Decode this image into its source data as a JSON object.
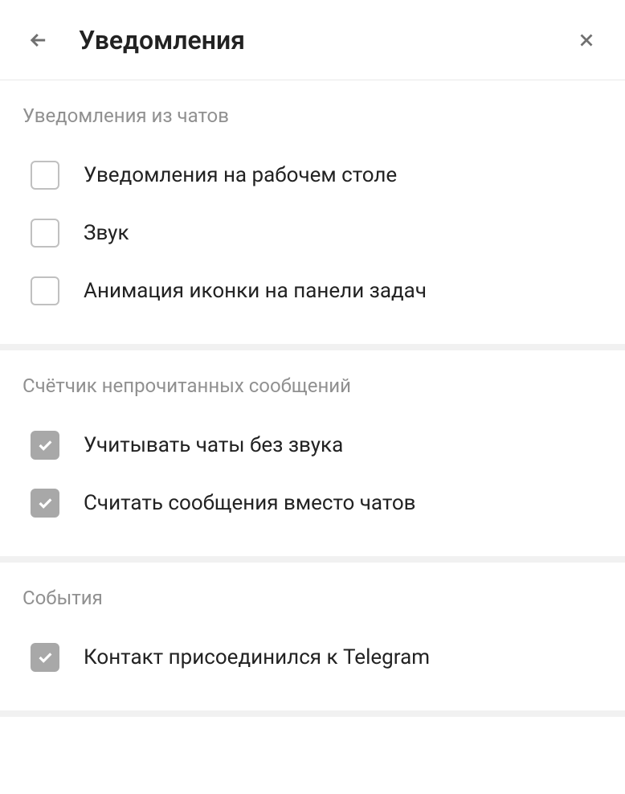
{
  "header": {
    "title": "Уведомления"
  },
  "sections": [
    {
      "title": "Уведомления из чатов",
      "options": [
        {
          "label": "Уведомления на рабочем столе",
          "checked": false
        },
        {
          "label": "Звук",
          "checked": false
        },
        {
          "label": "Анимация иконки на панели задач",
          "checked": false
        }
      ]
    },
    {
      "title": "Счётчик непрочитанных сообщений",
      "options": [
        {
          "label": "Учитывать чаты без звука",
          "checked": true
        },
        {
          "label": "Считать сообщения вместо чатов",
          "checked": true
        }
      ]
    },
    {
      "title": "События",
      "options": [
        {
          "label": "Контакт присоединился к Telegram",
          "checked": true
        }
      ]
    }
  ]
}
